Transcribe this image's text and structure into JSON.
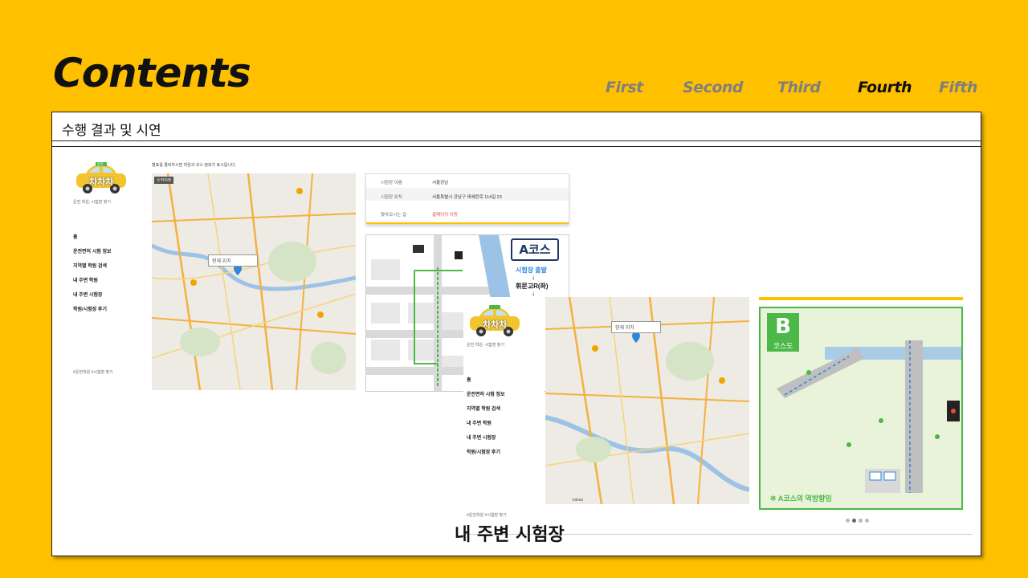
{
  "slide": {
    "title": "Contents",
    "nav": [
      {
        "label": "First",
        "active": false
      },
      {
        "label": "Second",
        "active": false
      },
      {
        "label": "Third",
        "active": false
      },
      {
        "label": "Fourth",
        "active": true
      },
      {
        "label": "Fifth",
        "active": false
      }
    ],
    "panel_title": "수행 결과 및 시연",
    "caption": "내 주변 시험장"
  },
  "app_back": {
    "logo_text": "차차차",
    "logo_badge": "운전",
    "tagline": "운전 학원, 시험장 찾기",
    "menu": [
      "홈",
      "운전면허 시험 정보",
      "지역별 학원 검색",
      "내 주변 학원",
      "내 주변 시험장",
      "학원/시험장 후기"
    ],
    "footer": "#운전학원 #시험장 찾기",
    "instruction": "별표를 클릭하시면 학원과 코스 정보가 표시됩니다.",
    "map_button": "스카이뷰",
    "search_placeholder": "현재 위치",
    "info": [
      {
        "label": "시험장 이름",
        "value": "서울강남"
      },
      {
        "label": "시험장 위치",
        "value": "서울특별시 강남구 테헤란로 114길 23"
      },
      {
        "label": "찾아오시는 길",
        "value": "홈페이지 이동"
      }
    ],
    "course_a": {
      "title": "A코스",
      "start": "시험장 출발",
      "step": "휘문고R(좌)"
    }
  },
  "app_front": {
    "logo_text": "차차차",
    "tagline": "운전 학원, 시험장 찾기",
    "menu": [
      "홈",
      "운전면허 시험 정보",
      "지역별 학원 검색",
      "내 주변 학원",
      "내 주변 시험장",
      "학원/시험장 후기"
    ],
    "footer": "#운전학원 #시험장 찾기",
    "search_placeholder": "현재 위치",
    "map_credit": "kakao",
    "course_b": {
      "letter": "B",
      "label": "코스도",
      "note": "※ A코스의 역방향임"
    }
  },
  "colors": {
    "background": "#FFC000",
    "course_green": "#4CB848",
    "course_navy": "#1F3864",
    "route_blue": "#5A9BD5",
    "map_road": "#F5B041",
    "link_red": "#E74C3C"
  }
}
